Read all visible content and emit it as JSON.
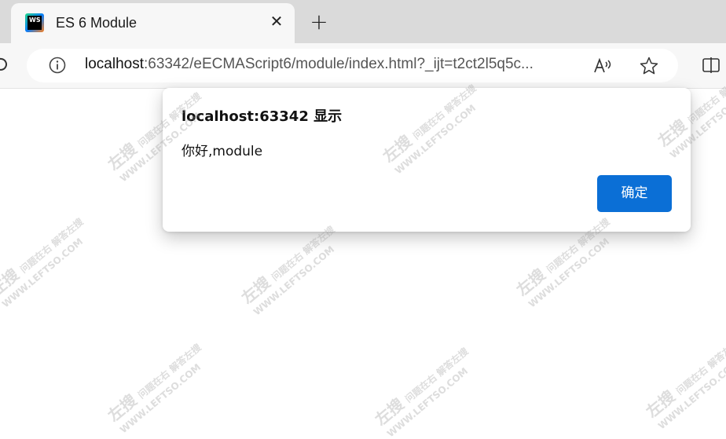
{
  "tab": {
    "favicon_text": "WS",
    "title": "ES 6 Module",
    "close": "✕"
  },
  "new_tab": "+",
  "address": {
    "url_host": "localhost",
    "url_rest": ":63342/eECMAScript6/module/index.html?_ijt=t2ct2l5q5c..."
  },
  "dialog": {
    "title": "localhost:63342 显示",
    "message": "你好,module",
    "ok_label": "确定"
  },
  "watermark": {
    "brand": "左搜",
    "tag": "问题在右 解答左搜",
    "site": "WWW.LEFTSO.COM"
  },
  "colors": {
    "tabbar": "#dadada",
    "toolbar": "#f7f7f7",
    "ok_button": "#0b6fd6"
  }
}
